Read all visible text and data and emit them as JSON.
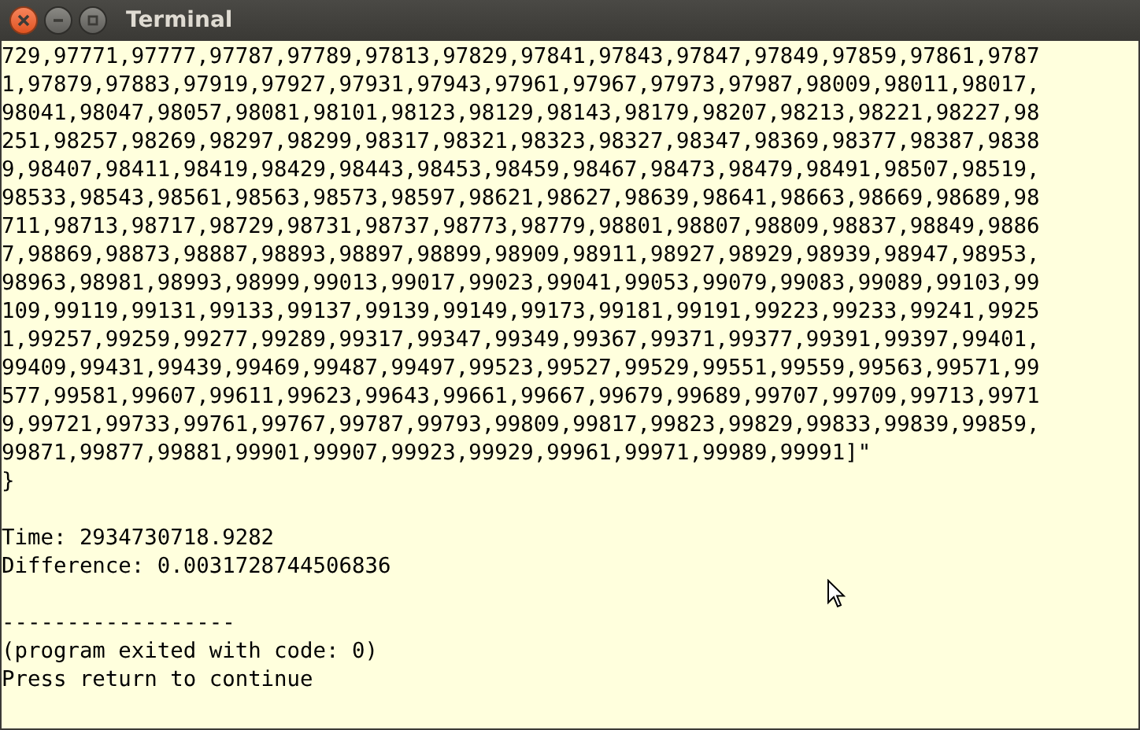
{
  "window": {
    "title": "Terminal"
  },
  "terminal": {
    "groups": [
      [
        "729,97771,97777,97787,97789,97813,97829,97841,97843,97847,97849,97859,97861,9787",
        "1,97879,97883,97919,97927,97931,97943,97961,97967,97973,97987,98009,98011,98017,",
        "98041,98047,98057,98081,98101,98123,98129,98143,98179,98207,98213,98221,98227,98",
        "251,98257,98269,98297,98299,98317,98321,98323,98327,98347,98369,98377,98387,9838",
        "9,98407,98411,98419,98429,98443,98453,98459,98467,98473,98479,98491,98507,98519,",
        "98533,98543,98561,98563,98573,98597,98621,98627,98639,98641,98663,98669,98689,98",
        "711,98713,98717,98729,98731,98737,98773,98779,98801,98807,98809,98837,98849,9886",
        "7,98869,98873,98887,98893,98897,98899,98909,98911,98927,98929,98939,98947,98953,",
        "98963,98981,98993,98999,99013,99017,99023,99041,99053,99079,99083,99089,99103,99",
        "109,99119,99131,99133,99137,99139,99149,99173,99181,99191,99223,99233,99241,9925",
        "1,99257,99259,99277,99289,99317,99347,99349,99367,99371,99377,99391,99397,99401,",
        "99409,99431,99439,99469,99487,99497,99523,99527,99529,99551,99559,99563,99571,99",
        "577,99581,99607,99611,99623,99643,99661,99667,99679,99689,99707,99709,99713,9971",
        "9,99721,99733,99761,99767,99787,99793,99809,99817,99823,99829,99833,99839,99859,",
        "99871,99877,99881,99901,99907,99923,99929,99961,99971,99989,99991]\"",
        "}"
      ],
      [
        "Time: 2934730718.9282",
        "Difference: 0.0031728744506836"
      ],
      [
        "------------------",
        "(program exited with code: 0)",
        "Press return to continue"
      ]
    ]
  }
}
